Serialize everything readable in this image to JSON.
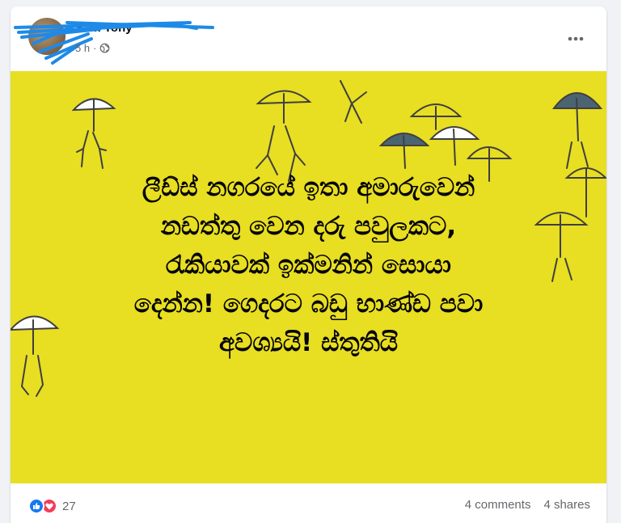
{
  "post": {
    "author": "Sam Tony",
    "time": "5 h",
    "separator": "·",
    "privacy_icon": "globe-icon",
    "menu_icon": "more-options-icon",
    "text": "ලීඩ්ස් නගරයේ ඉතා අමාරුවෙන්\nනඩත්තු වෙන දරු පවුලකට,\nරැකියාවක් ඉක්මනින් සොයා\nදෙන්න! ගෙදරට බඩු භාණ්ඩ පවා\nඅවශ්‍යයි! ස්තුතියි",
    "image_bg_color": "#e8de22",
    "art_colors": {
      "umbrella_dark": "#4c6472",
      "umbrella_white": "#ffffff",
      "line": "#3f3f3f"
    }
  },
  "footer": {
    "reaction_icons": [
      "like-icon",
      "love-icon"
    ],
    "reaction_count": "27",
    "comments": "4 comments",
    "shares": "4 shares"
  },
  "colors": {
    "page_bg": "#f0f2f5",
    "card_bg": "#ffffff",
    "secondary_text": "#65676b",
    "like_blue": "#1877f2",
    "love_red": "#f33e58",
    "scribble_blue": "#1e8ae8"
  }
}
